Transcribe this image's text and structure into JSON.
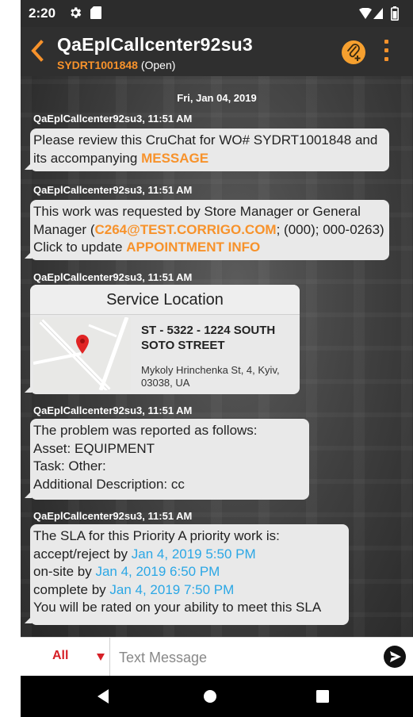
{
  "status_bar": {
    "time": "2:20",
    "icons": [
      "gear-icon",
      "sd-card-icon",
      "wifi-icon",
      "signal-icon",
      "battery-icon"
    ]
  },
  "header": {
    "title": "QaEplCallcenter92su3",
    "work_order": "SYDRT1001848",
    "status": "(Open)",
    "icons": [
      "back-arrow-icon",
      "attachment-add-icon",
      "more-vert-icon"
    ]
  },
  "chat": {
    "date": "Fri, Jan 04, 2019",
    "messages": [
      {
        "sender": "QaEplCallcenter92su3, 11:51 AM",
        "text1": "Please review this CruChat for WO# SYDRT1001848 and its accompanying ",
        "link": "MESSAGE"
      },
      {
        "sender": "QaEplCallcenter92su3, 11:51 AM",
        "text1": "This work was requested by Store Manager or General Manager (",
        "email": "C264@TEST.CORRIGO.COM",
        "text2": "; (000); 000-0263)",
        "text3": "Click to update ",
        "link": "APPOINTMENT INFO"
      },
      {
        "sender": "QaEplCallcenter92su3, 11:51 AM",
        "card_title": "Service Location",
        "location_name": "ST - 5322 - 1224 SOUTH SOTO STREET",
        "address": "Mykoly Hrinchenka St, 4, Kyiv, 03038, UA"
      },
      {
        "sender": "QaEplCallcenter92su3, 11:51 AM",
        "intro": "The problem was reported as follows:",
        "asset_label": "Asset:",
        "asset_value": "EQUIPMENT",
        "task_label": "Task:",
        "task_value": "Other:",
        "desc_label": "Additional Description:",
        "desc_value": "cc"
      },
      {
        "sender": "QaEplCallcenter92su3, 11:51 AM",
        "intro": "The SLA for this Priority A priority work is:",
        "accept_label": "accept/reject by ",
        "accept_time": "Jan 4, 2019 5:50 PM",
        "onsite_label": "on-site by ",
        "onsite_time": "Jan 4, 2019 6:50 PM",
        "complete_label": "complete by ",
        "complete_time": "Jan 4, 2019 7:50 PM",
        "footer": "You will be rated on your ability to meet this SLA"
      }
    ]
  },
  "composer": {
    "filter_value": "All",
    "placeholder": "Text Message",
    "icons": [
      "dropdown-caret-icon",
      "send-icon"
    ]
  },
  "nav_bar": {
    "icons": [
      "nav-back-icon",
      "nav-home-icon",
      "nav-recents-icon"
    ]
  },
  "colors": {
    "accent_orange": "#f7922b",
    "link_blue": "#2ba7e5",
    "filter_red": "#d62027",
    "bubble": "#e9e9e9"
  }
}
